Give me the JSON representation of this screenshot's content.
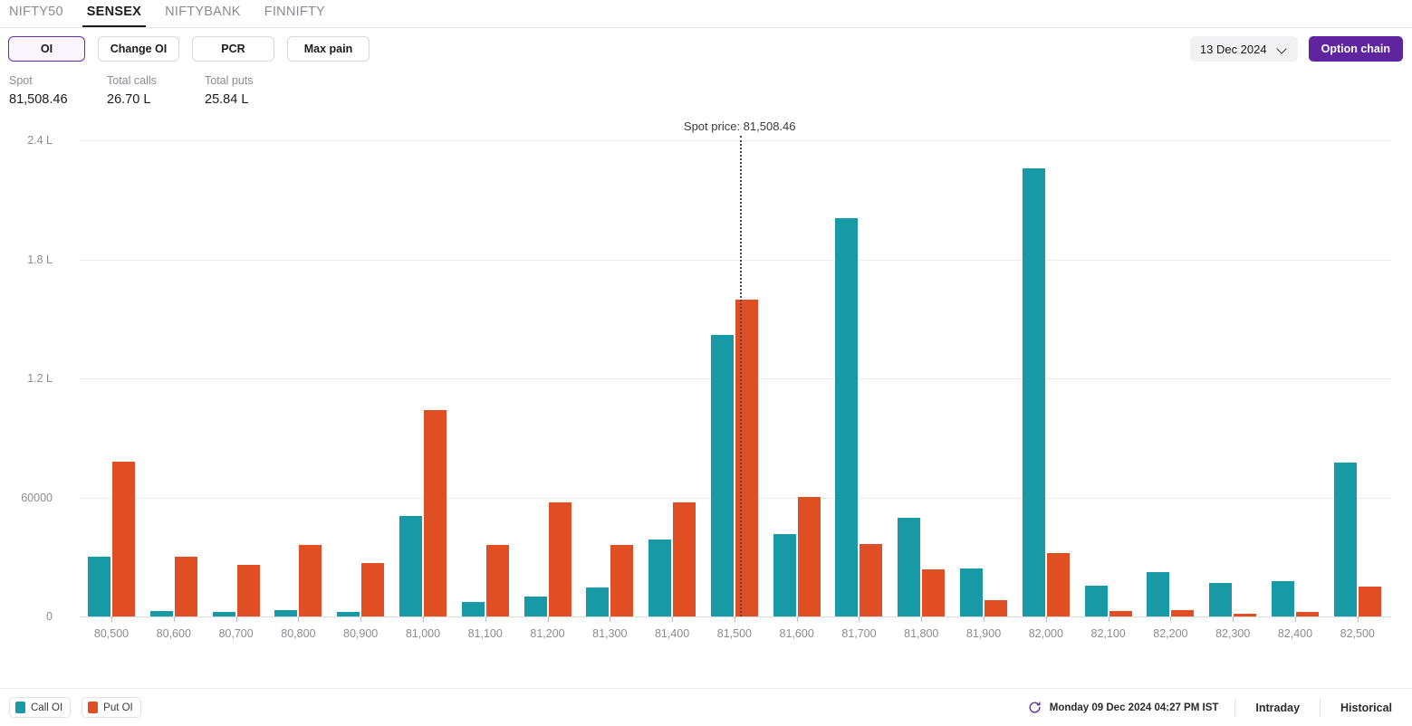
{
  "tabs": [
    {
      "label": "NIFTY50",
      "active": false
    },
    {
      "label": "SENSEX",
      "active": true
    },
    {
      "label": "NIFTYBANK",
      "active": false
    },
    {
      "label": "FINNIFTY",
      "active": false
    }
  ],
  "metric_buttons": [
    {
      "label": "OI",
      "active": true
    },
    {
      "label": "Change OI",
      "active": false
    },
    {
      "label": "PCR",
      "active": false
    },
    {
      "label": "Max pain",
      "active": false
    }
  ],
  "date_picker": {
    "value": "13 Dec 2024",
    "icon": "chevron-down-icon"
  },
  "option_chain_button": {
    "label": "Option chain"
  },
  "stats": [
    {
      "label": "Spot",
      "value": "81,508.46"
    },
    {
      "label": "Total calls",
      "value": "26.70 L"
    },
    {
      "label": "Total puts",
      "value": "25.84 L"
    }
  ],
  "legend": [
    {
      "label": "Call OI",
      "color": "#1799a6"
    },
    {
      "label": "Put OI",
      "color": "#e04e23"
    }
  ],
  "footer": {
    "refresh_icon": "refresh-icon",
    "timestamp": "Monday 09 Dec 2024 04:27 PM IST",
    "modes": [
      {
        "label": "Intraday",
        "active": true
      },
      {
        "label": "Historical",
        "active": false
      }
    ]
  },
  "chart_data": {
    "type": "bar",
    "title": "",
    "xlabel": "",
    "ylabel": "",
    "grid": true,
    "legend_position": "bottom-left",
    "ylim": [
      0,
      240000
    ],
    "ytick_values": [
      0,
      60000,
      120000,
      180000,
      240000
    ],
    "ytick_labels": [
      "0",
      "60000",
      "1.2 L",
      "1.8 L",
      "2.4 L"
    ],
    "categories": [
      "80,500",
      "80,600",
      "80,700",
      "80,800",
      "80,900",
      "81,000",
      "81,100",
      "81,200",
      "81,300",
      "81,400",
      "81,500",
      "81,600",
      "81,700",
      "81,800",
      "81,900",
      "82,000",
      "82,100",
      "82,200",
      "82,300",
      "82,400",
      "82,500"
    ],
    "series": [
      {
        "name": "Call OI",
        "color": "#1799a6",
        "values": [
          30000,
          2700,
          2300,
          3000,
          2300,
          50500,
          7200,
          10000,
          14500,
          39000,
          141900,
          41400,
          200700,
          49800,
          24400,
          225900,
          15400,
          22400,
          17100,
          17600,
          77600
        ]
      },
      {
        "name": "Put OI",
        "color": "#e04e23",
        "values": [
          78000,
          30000,
          26000,
          36000,
          27000,
          104000,
          36000,
          57600,
          36000,
          57600,
          159700,
          60300,
          36400,
          23900,
          8200,
          31800,
          2700,
          3200,
          1400,
          2200,
          15000
        ]
      }
    ],
    "annotation": {
      "label": "Spot price: 81,508.46",
      "x_value": 81508.46,
      "style": "dotted-vertical-line"
    }
  }
}
